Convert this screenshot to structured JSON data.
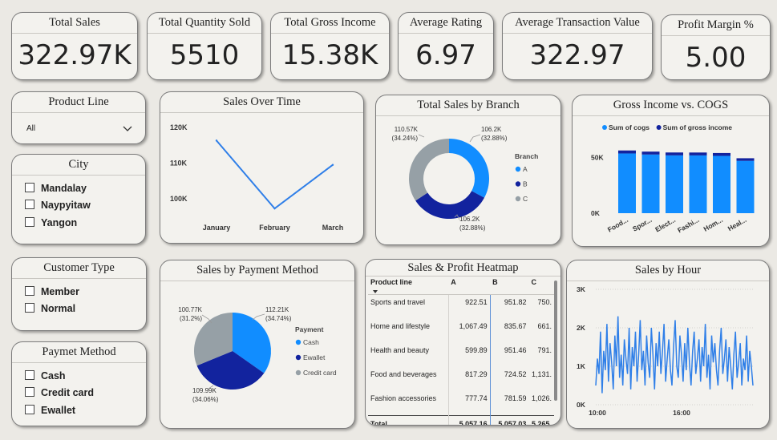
{
  "kpis": {
    "total_sales": {
      "label": "Total Sales",
      "value": "322.97K"
    },
    "total_quantity": {
      "label": "Total Quantity Sold",
      "value": "5510"
    },
    "gross_income": {
      "label": "Total Gross Income",
      "value": "15.38K"
    },
    "avg_rating": {
      "label": "Average Rating",
      "value": "6.97"
    },
    "avg_transaction": {
      "label": "Average Transaction Value",
      "value": "322.97"
    },
    "profit_margin": {
      "label": "Profit Margin %",
      "value": "5.00"
    }
  },
  "slicers": {
    "product_line": {
      "title": "Product Line",
      "selected": "All"
    },
    "city": {
      "title": "City",
      "options": [
        "Mandalay",
        "Naypyitaw",
        "Yangon"
      ]
    },
    "customer_type": {
      "title": "Customer Type",
      "options": [
        "Member",
        "Normal"
      ]
    },
    "payment": {
      "title": "Paymet Method",
      "options": [
        "Cash",
        "Credit card",
        "Ewallet"
      ]
    }
  },
  "colors": {
    "blue": "#118dff",
    "navy": "#12239e",
    "gray": "#96a0a6",
    "line": "#2f7fe8"
  },
  "chart_data": [
    {
      "id": "sales_over_time",
      "type": "line",
      "title": "Sales Over Time",
      "categories": [
        "January",
        "February",
        "March"
      ],
      "values": [
        116.29,
        97.22,
        109.46
      ],
      "y_ticks": [
        "120K",
        "110K",
        "100K"
      ],
      "ylim": [
        95,
        122
      ],
      "grid": false
    },
    {
      "id": "sales_by_branch",
      "type": "pie",
      "title": "Total Sales by Branch",
      "legend_title": "Branch",
      "legend_position": "right",
      "donut": true,
      "slices": [
        {
          "label": "A",
          "value": 106.2,
          "label_text": "106.2K",
          "pct_text": "(32.88%)",
          "color": "#118dff"
        },
        {
          "label": "B",
          "value": 106.2,
          "label_text": "106.2K",
          "pct_text": "(32.88%)",
          "color": "#12239e"
        },
        {
          "label": "C",
          "value": 110.57,
          "label_text": "110.57K",
          "pct_text": "(34.24%)",
          "color": "#96a0a6"
        }
      ]
    },
    {
      "id": "gross_vs_cogs",
      "type": "bar",
      "stacked": true,
      "title": "Gross Income vs. COGS",
      "legend_position": "top",
      "categories": [
        "Food...",
        "Spor...",
        "Elect...",
        "Fashi...",
        "Hom...",
        "Heal..."
      ],
      "series": [
        {
          "name": "Sum of cogs",
          "values": [
            53.47,
            52.5,
            51.75,
            51.72,
            51.3,
            46.85
          ],
          "color": "#118dff"
        },
        {
          "name": "Sum of gross income",
          "values": [
            2.67,
            2.62,
            2.59,
            2.59,
            2.56,
            2.34
          ],
          "color": "#12239e"
        }
      ],
      "y_ticks": [
        "50K",
        "0K"
      ],
      "ylim": [
        0,
        66
      ]
    },
    {
      "id": "sales_by_payment",
      "type": "pie",
      "title": "Sales by Payment Method",
      "legend_title": "Payment",
      "legend_position": "right",
      "slices": [
        {
          "label": "Cash",
          "value": 112.21,
          "label_text": "112.21K",
          "pct_text": "(34.74%)",
          "color": "#118dff"
        },
        {
          "label": "Ewallet",
          "value": 109.99,
          "label_text": "109.99K",
          "pct_text": "(34.06%)",
          "color": "#12239e"
        },
        {
          "label": "Credit card",
          "value": 100.77,
          "label_text": "100.77K",
          "pct_text": "(31.2%)",
          "color": "#96a0a6"
        }
      ]
    },
    {
      "id": "sales_heatmap",
      "type": "table",
      "title": "Sales & Profit Heatmap",
      "columns": [
        "Product line",
        "A",
        "B",
        "C"
      ],
      "rows": [
        [
          "Sports and travel",
          "922.51",
          "951.82",
          "750."
        ],
        [
          "Home and lifestyle",
          "1,067.49",
          "835.67",
          "661."
        ],
        [
          "Health and beauty",
          "599.89",
          "951.46",
          "791."
        ],
        [
          "Food and beverages",
          "817.29",
          "724.52",
          "1,131."
        ],
        [
          "Fashion accessories",
          "777.74",
          "781.59",
          "1,026."
        ]
      ],
      "total": [
        "Total",
        "5,057.16",
        "5,057.03",
        "5,265."
      ]
    },
    {
      "id": "sales_by_hour",
      "type": "line",
      "title": "Sales by Hour",
      "x_ticks": [
        "10:00",
        "16:00"
      ],
      "y_ticks": [
        "3K",
        "2K",
        "1K",
        "0K"
      ],
      "ylim": [
        0,
        3
      ],
      "grid": true,
      "values": [
        0.5,
        1.2,
        0.8,
        1.9,
        0.3,
        1.4,
        0.9,
        2.1,
        0.6,
        1.6,
        1.1,
        0.4,
        1.8,
        1.0,
        2.3,
        0.7,
        1.3,
        0.5,
        1.7,
        1.2,
        0.8,
        2.0,
        0.4,
        1.5,
        1.0,
        1.9,
        0.6,
        1.3,
        2.2,
        0.9,
        1.4,
        0.5,
        1.8,
        1.1,
        0.7,
        2.0,
        1.3,
        0.4,
        1.6,
        1.0,
        1.9,
        0.8,
        1.4,
        2.1,
        0.6,
        1.2,
        1.7,
        0.9,
        0.5,
        1.5,
        2.2,
        1.0,
        0.7,
        1.8,
        1.3,
        0.6,
        1.6,
        0.9,
        2.0,
        1.1,
        0.5,
        1.4,
        1.9,
        0.8,
        1.2,
        1.7,
        0.6,
        1.5,
        1.0,
        2.1,
        0.7,
        1.3,
        0.4,
        1.8,
        1.1,
        1.6,
        0.9,
        0.5,
        1.4,
        2.0,
        0.8,
        1.2,
        1.7,
        0.6,
        1.5,
        1.0,
        0.4,
        1.3,
        1.9,
        0.7,
        1.1,
        1.6,
        0.5,
        1.2,
        0.9,
        1.8,
        0.6,
        1.4,
        1.0,
        0.5
      ]
    }
  ]
}
